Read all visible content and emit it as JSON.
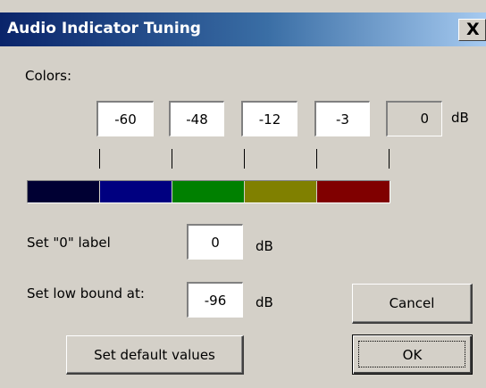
{
  "window": {
    "title": "Audio Indicator Tuning",
    "close_glyph": "X"
  },
  "colors_label": "Colors:",
  "thresholds": [
    "-60",
    "-48",
    "-12",
    "-3"
  ],
  "top_value": "0",
  "db_unit": "dB",
  "segment_colors": [
    "#000033",
    "#000080",
    "#008000",
    "#808000",
    "#800000"
  ],
  "zero_label": {
    "label": "Set \"0\" label",
    "value": "0",
    "unit": "dB"
  },
  "low_bound": {
    "label": "Set low bound at:",
    "value": "-96",
    "unit": "dB"
  },
  "buttons": {
    "cancel": "Cancel",
    "ok": "OK",
    "defaults": "Set default values"
  }
}
